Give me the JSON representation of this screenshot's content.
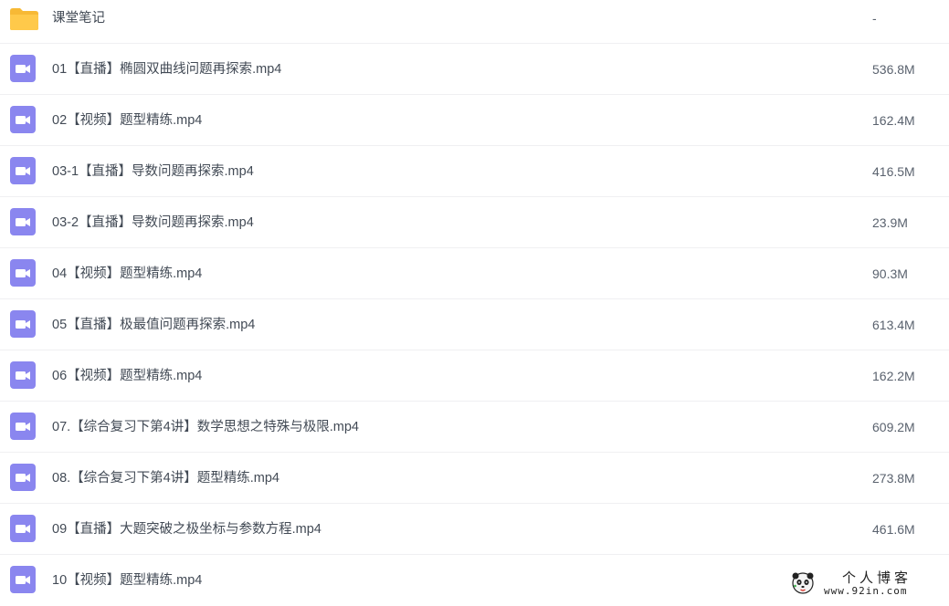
{
  "files": [
    {
      "name": "课堂笔记",
      "size": "-",
      "icon": "folder-icon"
    },
    {
      "name": "01【直播】椭圆双曲线问题再探索.mp4",
      "size": "536.8M",
      "icon": "video-icon"
    },
    {
      "name": "02【视频】题型精练.mp4",
      "size": "162.4M",
      "icon": "video-icon"
    },
    {
      "name": "03-1【直播】导数问题再探索.mp4",
      "size": "416.5M",
      "icon": "video-icon"
    },
    {
      "name": "03-2【直播】导数问题再探索.mp4",
      "size": "23.9M",
      "icon": "video-icon"
    },
    {
      "name": "04【视频】题型精练.mp4",
      "size": "90.3M",
      "icon": "video-icon"
    },
    {
      "name": "05【直播】极最值问题再探索.mp4",
      "size": "613.4M",
      "icon": "video-icon"
    },
    {
      "name": "06【视频】题型精练.mp4",
      "size": "162.2M",
      "icon": "video-icon"
    },
    {
      "name": "07.【综合复习下第4讲】数学思想之特殊与极限.mp4",
      "size": "609.2M",
      "icon": "video-icon"
    },
    {
      "name": "08.【综合复习下第4讲】题型精练.mp4",
      "size": "273.8M",
      "icon": "video-icon"
    },
    {
      "name": "09【直播】大题突破之极坐标与参数方程.mp4",
      "size": "461.6M",
      "icon": "video-icon"
    },
    {
      "name": "10【视频】题型精练.mp4",
      "size": "",
      "icon": "video-icon"
    }
  ],
  "watermark": {
    "title": "个人博客",
    "url": "www.92in.com"
  },
  "colors": {
    "video_icon": "#8a86ef",
    "folder_icon": "#ffc94a",
    "text": "#424a55",
    "divider": "#f0f0f2"
  }
}
